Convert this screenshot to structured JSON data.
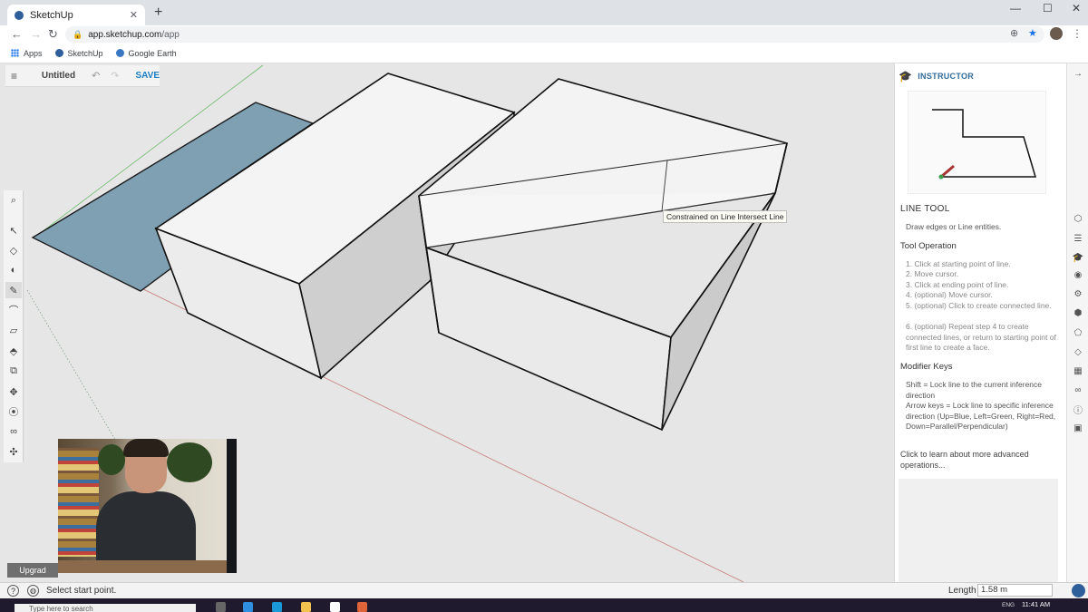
{
  "browser": {
    "tab_title": "SketchUp",
    "tab_close": "✕",
    "new_tab": "+",
    "url_host": "app.sketchup.com",
    "url_path": "/app",
    "bookmarks": [
      {
        "label": "Apps"
      },
      {
        "label": "SketchUp"
      },
      {
        "label": "Google Earth"
      }
    ],
    "window_controls": [
      "—",
      "☐",
      "✕"
    ]
  },
  "toolbar": {
    "menu_icon": "≡",
    "doc_title": "Untitled",
    "undo_icon": "↶",
    "redo_icon": "↷",
    "save_label": "SAVE"
  },
  "left_tools": [
    {
      "name": "search-icon",
      "glyph": "⌕"
    },
    {
      "name": "select-tool-icon",
      "glyph": "↖"
    },
    {
      "name": "eraser-tool-icon",
      "glyph": "◇"
    },
    {
      "name": "paint-bucket-icon",
      "glyph": "◐"
    },
    {
      "name": "line-tool-icon",
      "glyph": "✎"
    },
    {
      "name": "arc-tool-icon",
      "glyph": "⌒"
    },
    {
      "name": "rectangle-tool-icon",
      "glyph": "▱"
    },
    {
      "name": "push-pull-icon",
      "glyph": "⬘"
    },
    {
      "name": "offset-tool-icon",
      "glyph": "⧉"
    },
    {
      "name": "move-tool-icon",
      "glyph": "✥"
    },
    {
      "name": "tape-measure-icon",
      "glyph": "⦿"
    },
    {
      "name": "footprint-icon",
      "glyph": "∞"
    },
    {
      "name": "orbit-tool-icon",
      "glyph": "✣"
    }
  ],
  "viewport": {
    "tooltip": "Constrained on Line Intersect Line"
  },
  "webcam": {
    "label": "Upgrad"
  },
  "instructor": {
    "header": "INSTRUCTOR",
    "tool_name": "LINE TOOL",
    "description": "Draw edges or Line entities.",
    "operation_heading": "Tool Operation",
    "steps": [
      "1. Click at starting point of line.",
      "2. Move cursor.",
      "3. Click at ending point of line.",
      "4. (optional) Move cursor.",
      "5. (optional) Click to create connected line.",
      "6. (optional) Repeat step 4 to create connected lines, or return to starting point of first line to create a face."
    ],
    "modifier_heading": "Modifier Keys",
    "modifiers": [
      "Shift = Lock line to the current inference direction",
      "Arrow keys = Lock line to specific inference direction (Up=Blue, Left=Green, Right=Red, Down=Parallel/Perpendicular)"
    ],
    "more_link": "Click to learn about more advanced operations..."
  },
  "right_rail": [
    {
      "name": "entity-info-icon",
      "glyph": "⬡"
    },
    {
      "name": "outliner-icon",
      "glyph": "☰"
    },
    {
      "name": "instructor-icon",
      "glyph": "🎓"
    },
    {
      "name": "materials-icon",
      "glyph": "◉"
    },
    {
      "name": "components-icon",
      "glyph": "⚙"
    },
    {
      "name": "3d-warehouse-icon",
      "glyph": "⬢"
    },
    {
      "name": "styles-icon",
      "glyph": "⬠"
    },
    {
      "name": "tags-icon",
      "glyph": "◇"
    },
    {
      "name": "scenes-icon",
      "glyph": "▦"
    },
    {
      "name": "display-icon",
      "glyph": "∞"
    },
    {
      "name": "info-icon",
      "glyph": "ⓘ"
    },
    {
      "name": "extensions-icon",
      "glyph": "▣"
    }
  ],
  "status": {
    "help_icon": "?",
    "message": "Select start point.",
    "length_label": "Length",
    "length_value": "1.58 m"
  },
  "taskbar": {
    "search_placeholder": "Type here to search",
    "language": "ENG",
    "time": "11:41 AM"
  },
  "colors": {
    "selected_face": "#7f9fb2",
    "box_face_light": "#f4f4f4",
    "box_face_mid": "#e4e4e4",
    "box_face_dark": "#c9c9c9",
    "green_axis": "#4caf50",
    "red_axis": "#c0504d",
    "accent": "#2f6a9a"
  }
}
